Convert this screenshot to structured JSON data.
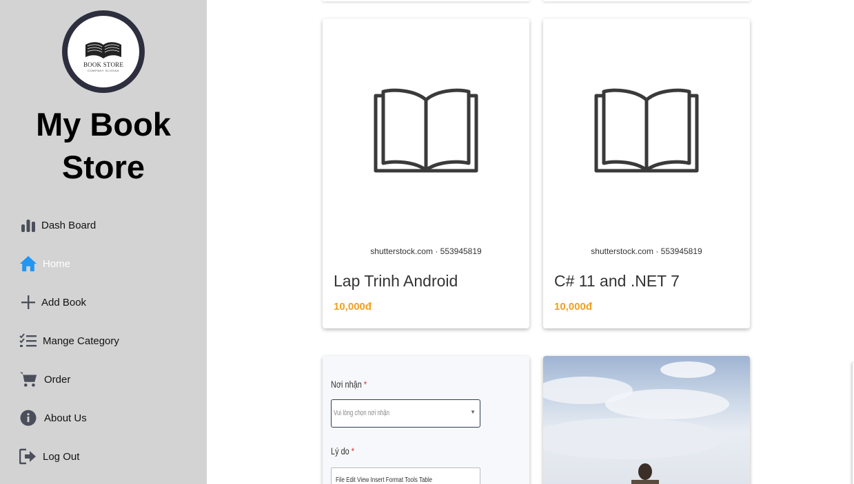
{
  "sidebar": {
    "logo": {
      "title": "BOOK STORE",
      "subtitle": "COMPANY SLOGAN"
    },
    "app_title": "My Book Store",
    "nav": [
      {
        "label": "Dash Board",
        "icon": "bar-chart-icon",
        "active": false
      },
      {
        "label": "Home",
        "icon": "home-icon",
        "active": true
      },
      {
        "label": "Add Book",
        "icon": "plus-icon",
        "active": false
      },
      {
        "label": "Mange Category",
        "icon": "checklist-icon",
        "active": false
      },
      {
        "label": "Order",
        "icon": "cart-icon",
        "active": false
      },
      {
        "label": "About Us",
        "icon": "info-icon",
        "active": false
      },
      {
        "label": "Log Out",
        "icon": "logout-icon",
        "active": false
      }
    ],
    "active_color": "#2196f3"
  },
  "books": [
    {
      "title": "Lap Trinh Android",
      "price": "10,000đ",
      "image_watermark": "shutterstock.com · 553945819"
    },
    {
      "title": "C# 11 and .NET 7",
      "price": "10,000đ",
      "image_watermark": "shutterstock.com · 553945819"
    }
  ],
  "form_screenshot": {
    "label1": "Nơi nhận",
    "required_mark": "*",
    "select_placeholder": "Vui lòng chọn nơi nhận",
    "label2": "Lý do",
    "editor_menu": "File   Edit   View   Insert   Format   Tools   Table"
  },
  "colors": {
    "price": "#f0a020",
    "sidebar_bg": "#d3d3d3"
  }
}
